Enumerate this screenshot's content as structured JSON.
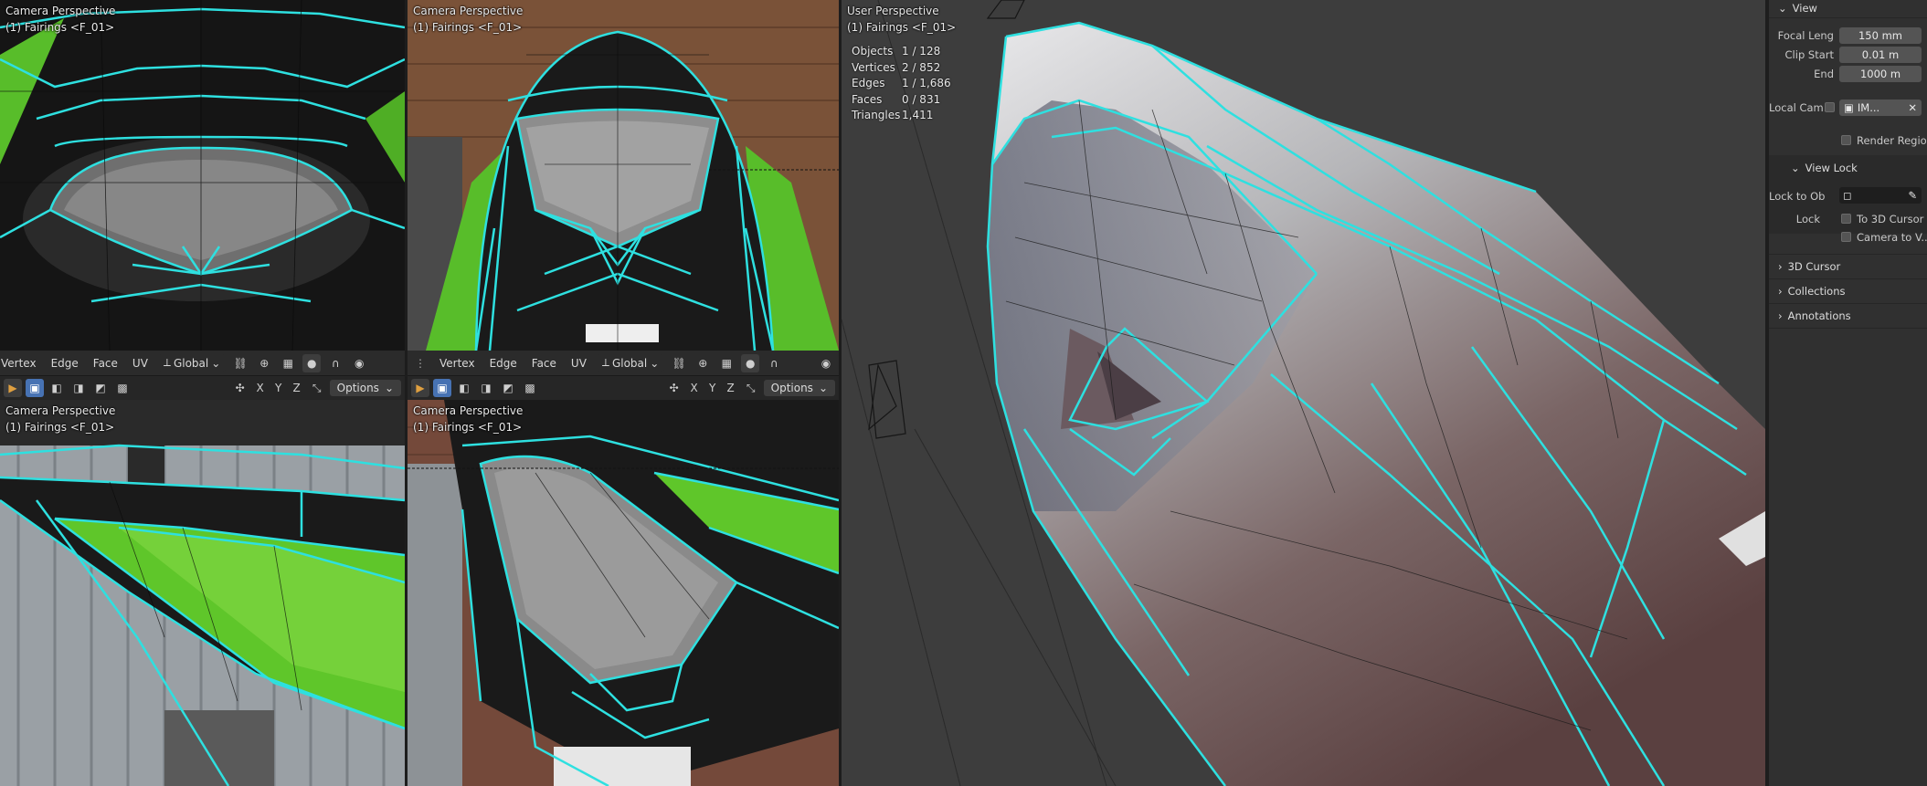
{
  "viewports": {
    "top_left": {
      "line1": "Camera Perspective",
      "line2": "(1) Fairings <F_01>"
    },
    "top_mid": {
      "line1": "Camera Perspective",
      "line2": "(1) Fairings <F_01>"
    },
    "bottom_left": {
      "line1": "Camera Perspective",
      "line2": "(1) Fairings <F_01>"
    },
    "bottom_mid": {
      "line1": "Camera Perspective",
      "line2": "(1) Fairings <F_01>"
    },
    "main": {
      "line1": "User Perspective",
      "line2": "(1) Fairings <F_01>"
    }
  },
  "header_left": {
    "menu": [
      "Vertex",
      "Edge",
      "Face",
      "UV"
    ],
    "transform_orientation": "Global",
    "options_label": "Options",
    "axes": [
      "X",
      "Y",
      "Z"
    ]
  },
  "header_mid": {
    "menu": [
      "Vertex",
      "Edge",
      "Face",
      "UV"
    ],
    "transform_orientation": "Global",
    "options_label": "Options",
    "axes": [
      "X",
      "Y",
      "Z"
    ]
  },
  "stats": {
    "objects_label": "Objects",
    "objects_value": "1 / 128",
    "vertices_label": "Vertices",
    "vertices_value": "2 / 852",
    "edges_label": "Edges",
    "edges_value": "1 / 1,686",
    "faces_label": "Faces",
    "faces_value": "0 / 831",
    "triangles_label": "Triangles",
    "triangles_value": "1,411"
  },
  "sidebar": {
    "view_title": "View",
    "focal_label": "Focal Leng",
    "focal_value": "150 mm",
    "clip_start_label": "Clip Start",
    "clip_start_value": "0.01 m",
    "end_label": "End",
    "end_value": "1000 m",
    "local_cam_label": "Local Cam...",
    "local_cam_value": "IM...",
    "render_region_label": "Render Region",
    "view_lock_title": "View Lock",
    "lock_to_ob_label": "Lock to Ob",
    "lock_label": "Lock",
    "to_3d_cursor_label": "To 3D Cursor",
    "camera_to_view_label": "Camera to V...",
    "cursor_title": "3D Cursor",
    "collections_title": "Collections",
    "annotations_title": "Annotations"
  },
  "colors": {
    "wire_selected": "#2ee0e0",
    "bike_green": "#5fc62a",
    "header_bg": "#2b2b2b",
    "panel_bg": "#303030",
    "active_blue": "#4772b3"
  }
}
